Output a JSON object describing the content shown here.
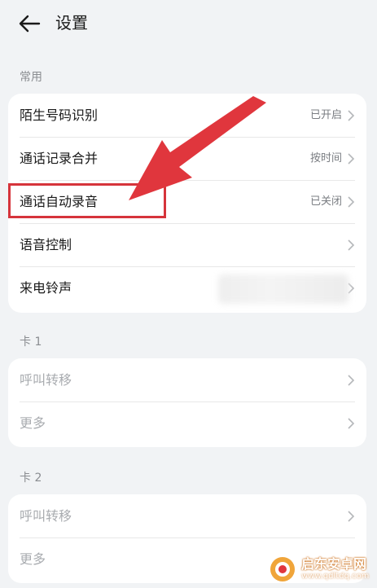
{
  "header": {
    "title": "设置"
  },
  "sections": [
    {
      "label": "常用",
      "rows": [
        {
          "label": "陌生号码识别",
          "value": "已开启"
        },
        {
          "label": "通话记录合并",
          "value": "按时间"
        },
        {
          "label": "通话自动录音",
          "value": "已关闭"
        },
        {
          "label": "语音控制"
        },
        {
          "label": "来电铃声"
        }
      ]
    },
    {
      "label": "卡 1",
      "rows": [
        {
          "label": "呼叫转移"
        },
        {
          "label": "更多"
        }
      ]
    },
    {
      "label": "卡 2",
      "rows": [
        {
          "label": "呼叫转移"
        },
        {
          "label": "更多"
        }
      ]
    }
  ],
  "annotation": {
    "color": "#d6343b"
  },
  "watermark": {
    "title": "启东安卓网",
    "url": "www.qdltdq.com"
  }
}
